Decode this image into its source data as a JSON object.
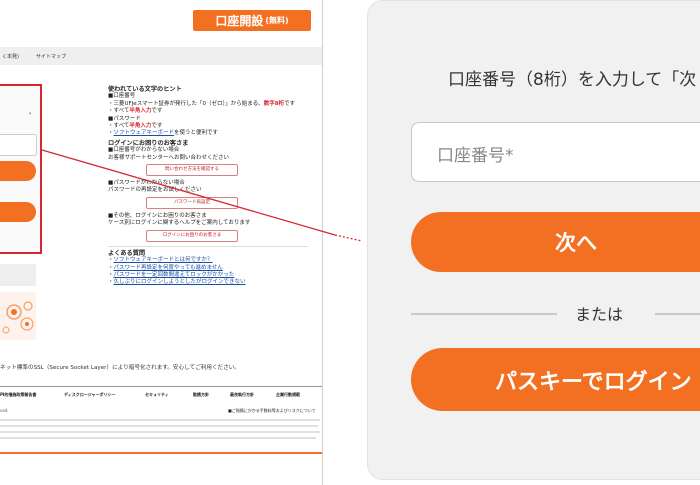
{
  "mini_page": {
    "open_account_label": "口座開設",
    "open_account_free": "(無料)",
    "nav": [
      "く本発)",
      "サイトマップ"
    ],
    "login_dot": "。",
    "hints": {
      "heading": "使われている文字のヒント",
      "account_heading": "■口座番号",
      "account_line1_a": "・三菱UFJeスマート証券が発行した「0（ゼロ）」から始まる、",
      "account_line1_b": "数字8桁",
      "account_line1_c": "です",
      "account_line2_a": "・すべて",
      "account_line2_b": "半角入力",
      "account_line2_c": "です",
      "password_heading": "■パスワード",
      "password_line1_a": "・すべて",
      "password_line1_b": "半角入力",
      "password_line1_c": "です",
      "password_line2_a": "・",
      "password_line2_link": "ソフトウェアキーボード",
      "password_line2_c": "を使うと便利です"
    },
    "trouble": {
      "heading": "ログインにお困りのお客さま",
      "q1_title": "■口座番号がわからない場合",
      "q1_desc": "お客様サポートセンターへお問い合わせください",
      "q1_button": "問い合わせ方法を確認する",
      "q2_title": "■パスワードがわからない場合",
      "q2_desc": "パスワードの再設定をお試しください",
      "q2_button": "パスワード再設定",
      "q3_title": "■その他、ログインにお困りのお客さま",
      "q3_desc": "ケース別にログインに関するヘルプをご案内しております",
      "q3_button": "ログインにお困りのお客さま"
    },
    "faq": {
      "heading": "よくある質問",
      "items": [
        "ソフトウェアキーボードとは何ですか？",
        "パスワード再設定を何度やっても進めません",
        "パスワードを一定回数間違えてロックがかかった",
        "久しぶりにログインしようとしたがログインできない"
      ]
    },
    "ssl_text": "ネット標準のSSL（Secure Socket Layer）により暗号化されます。安心してご利用ください。",
    "footer_links": [
      "PI的措施政策報告書",
      "ディスクロージャーポリシー",
      "セキュリティ",
      "勧誘方針",
      "最良執行方針",
      "企業行動規範"
    ],
    "footer_note": "■ご指摘にかかる手数料等およびリスクについて",
    "footer_small": "ved."
  },
  "zoom_panel": {
    "instruction": "口座番号（8桁）を入力して「次",
    "account_placeholder": "口座番号*",
    "next_label": "次へ",
    "or_label": "または",
    "passkey_label": "パスキーでログイン"
  },
  "colors": {
    "accent": "#f36f21",
    "highlight": "#d7262f",
    "link": "#1a4fa3"
  }
}
